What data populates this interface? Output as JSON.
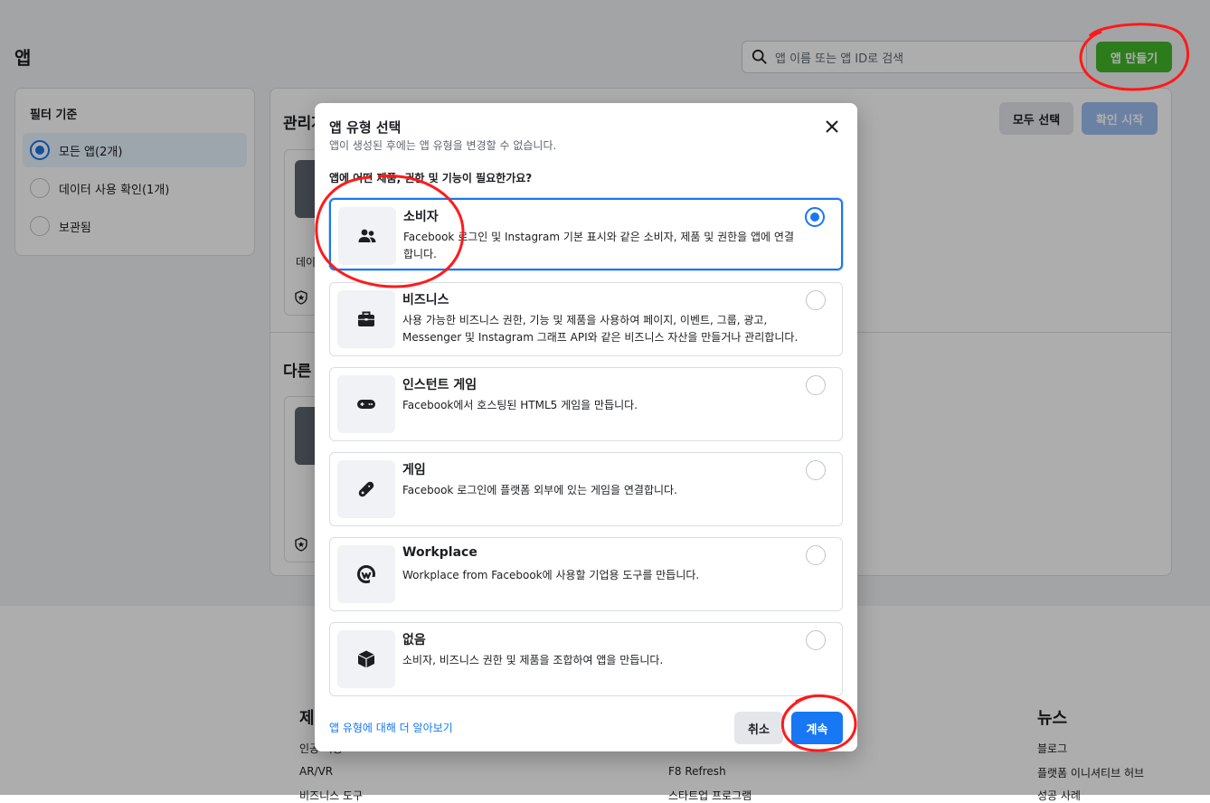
{
  "page": {
    "title": "앱",
    "search_placeholder": "앱 이름 또는 앱 ID로 검색",
    "create_button": "앱 만들기"
  },
  "filter": {
    "title": "필터 기준",
    "items": [
      {
        "label": "모든 앱(2개)",
        "selected": true
      },
      {
        "label": "데이터 사용 확인(1개)",
        "selected": false
      },
      {
        "label": "보관됨",
        "selected": false
      }
    ]
  },
  "main": {
    "section1_title": "관리자",
    "section2_title": "다른",
    "select_all": "모두 선택",
    "start_review": "확인 시작",
    "card_text": "데이"
  },
  "footer": {
    "col1_head": "제품",
    "col1_links": [
      "인공 지능",
      "AR/VR",
      "비즈니스 도구"
    ],
    "col2_links": [
      "F8 Refresh",
      "스타트업 프로그램"
    ],
    "col3_head": "뉴스",
    "col3_links": [
      "블로그",
      "플랫폼 이니셔티브 허브",
      "성공 사례"
    ]
  },
  "modal": {
    "title": "앱 유형 선택",
    "subtitle": "앱이 생성된 후에는 앱 유형을 변경할 수 없습니다.",
    "question": "앱에 어떤 제품, 권한 및 기능이 필요한가요?",
    "options": [
      {
        "icon": "people-icon",
        "title": "소비자",
        "desc": "Facebook 로그인 및 Instagram 기본 표시와 같은 소비자, 제품 및 권한을 앱에 연결합니다.",
        "selected": true
      },
      {
        "icon": "briefcase-icon",
        "title": "비즈니스",
        "desc": "사용 가능한 비즈니스 권한, 기능 및 제품을 사용하여 페이지, 이벤트, 그룹, 광고, Messenger 및 Instagram 그래프 API와 같은 비즈니스 자산을 만들거나 관리합니다.",
        "selected": false
      },
      {
        "icon": "gamepad-icon",
        "title": "인스턴트 게임",
        "desc": "Facebook에서 호스팅된 HTML5 게임을 만듭니다.",
        "selected": false
      },
      {
        "icon": "game-controller-icon",
        "title": "게임",
        "desc": "Facebook 로그인에 플랫폼 외부에 있는 게임을 연결합니다.",
        "selected": false
      },
      {
        "icon": "workplace-icon",
        "title": "Workplace",
        "desc": "Workplace from Facebook에 사용할 기업용 도구를 만듭니다.",
        "selected": false
      },
      {
        "icon": "cube-icon",
        "title": "없음",
        "desc": "소비자, 비즈니스 권한 및 제품을 조합하여 앱을 만듭니다.",
        "selected": false
      }
    ],
    "learn_more": "앱 유형에 대해 더 알아보기",
    "cancel": "취소",
    "continue": "계속"
  },
  "colors": {
    "primary": "#1877f2",
    "create_green": "#42b72a",
    "annotation_red": "#ff1a1a"
  }
}
